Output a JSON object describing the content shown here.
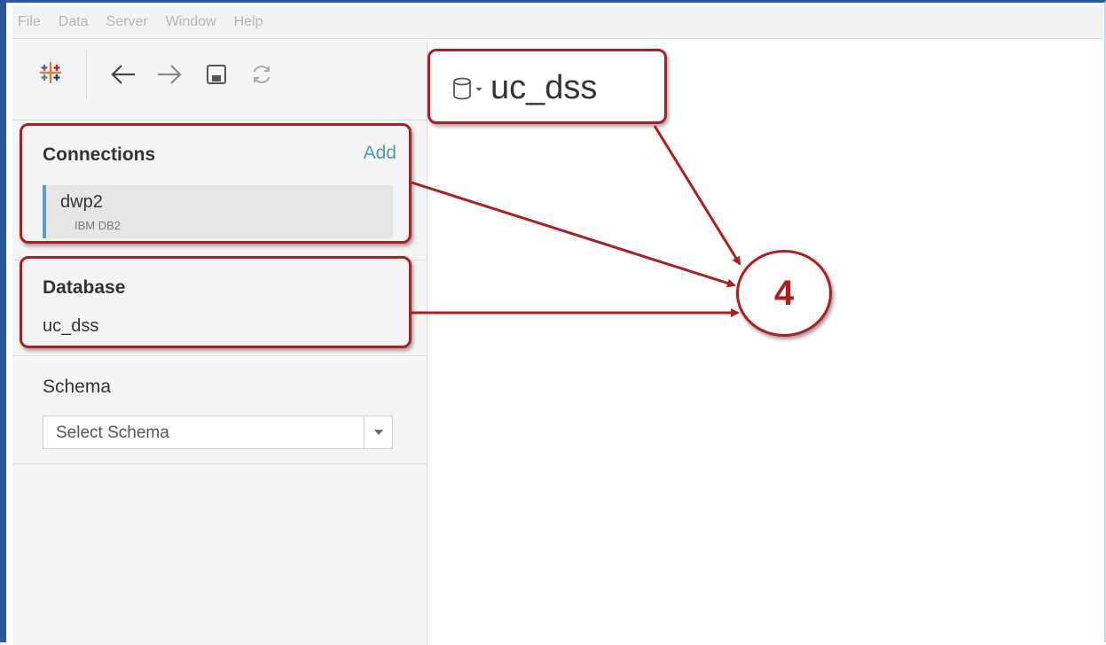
{
  "menubar": {
    "items": [
      "File",
      "Data",
      "Server",
      "Window",
      "Help"
    ]
  },
  "toolbar": {
    "icons": [
      "tableau-logo-icon",
      "back-arrow-icon",
      "forward-arrow-icon",
      "save-icon",
      "refresh-icon"
    ]
  },
  "connections": {
    "title": "Connections",
    "add_label": "Add",
    "items": [
      {
        "name": "dwp2",
        "type": "IBM DB2"
      }
    ]
  },
  "database": {
    "title": "Database",
    "value": "uc_dss"
  },
  "schema": {
    "title": "Schema",
    "placeholder": "Select Schema"
  },
  "datasource": {
    "title": "uc_dss",
    "icon": "database-icon"
  },
  "annotation": {
    "step_label": "4",
    "color": "#b01d1d"
  },
  "colors": {
    "accent": "#5b9ec9",
    "link": "#4a9cb8",
    "window_border": "#2b5797"
  }
}
